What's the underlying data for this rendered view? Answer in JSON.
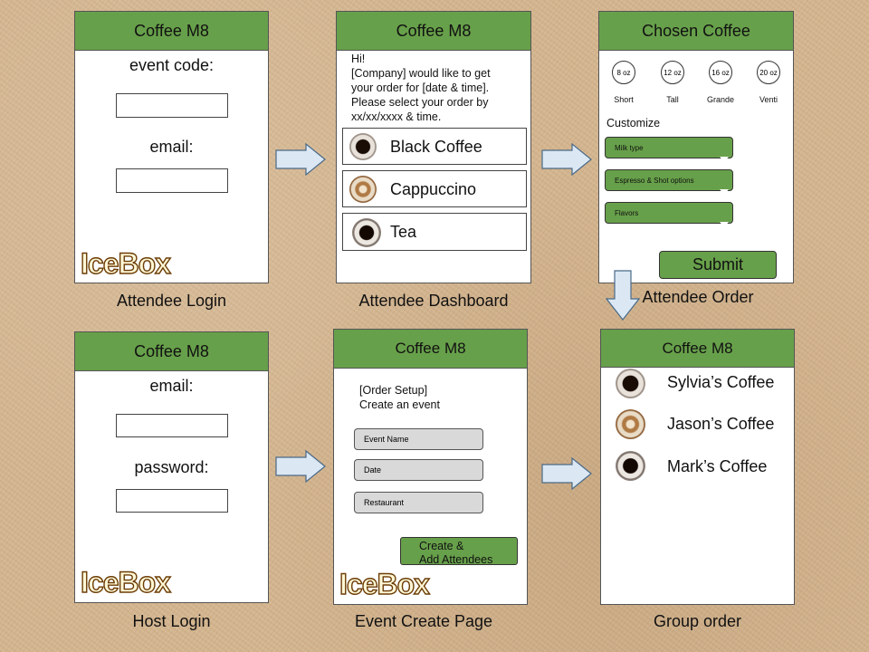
{
  "app_name": "Coffee M8",
  "logo_text": "IceBox",
  "attendee_login": {
    "caption": "Attendee Login",
    "event_code_label": "event code:",
    "email_label": "email:"
  },
  "attendee_dashboard": {
    "caption": "Attendee Dashboard",
    "greeting": "Hi!",
    "message_lines": [
      "[Company] would like to get",
      "your order for [date & time].",
      "Please select your order by",
      "xx/xx/xxxx & time."
    ],
    "items": [
      "Black Coffee",
      "Cappuccino",
      "Tea"
    ]
  },
  "attendee_order": {
    "caption": "Attendee Order",
    "title": "Chosen Coffee",
    "sizes": [
      {
        "oz": "8 oz",
        "name": "Short"
      },
      {
        "oz": "12 oz",
        "name": "Tall"
      },
      {
        "oz": "16 oz",
        "name": "Grande"
      },
      {
        "oz": "20 oz",
        "name": "Venti"
      }
    ],
    "customize_label": "Customize",
    "options": [
      "Milk type",
      "Espresso & Shot options",
      "Flavors"
    ],
    "submit_label": "Submit"
  },
  "host_login": {
    "caption": "Host Login",
    "email_label": "email:",
    "password_label": "password:"
  },
  "event_create": {
    "caption": "Event Create Page",
    "setup_line1": "[Order Setup]",
    "setup_line2": "Create an event",
    "fields": [
      "Event Name",
      "Date",
      "Restaurant"
    ],
    "button_line1": "Create &",
    "button_line2": "Add Attendees"
  },
  "group_order": {
    "caption": "Group order",
    "orders": [
      "Sylvia’s Coffee",
      "Jason’s Coffee",
      "Mark’s Coffee"
    ]
  },
  "colors": {
    "header_green": "#67a04a",
    "background": "#d3b48d",
    "arrow_fill": "#dbe8f4",
    "arrow_stroke": "#4a6a88"
  }
}
